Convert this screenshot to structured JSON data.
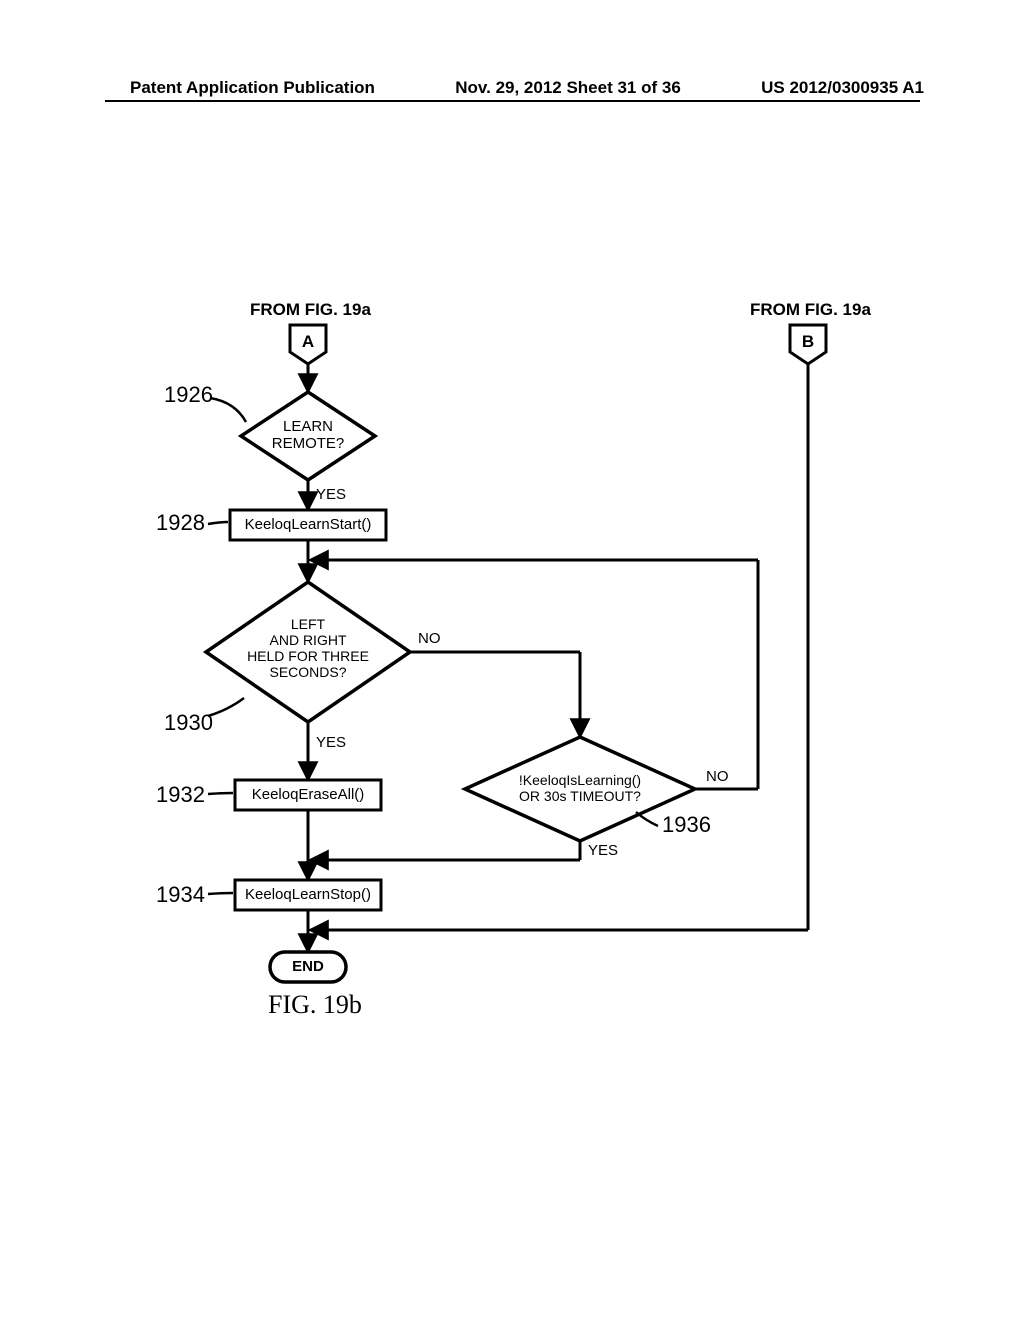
{
  "header": {
    "left": "Patent Application Publication",
    "center": "Nov. 29, 2012  Sheet 31 of 36",
    "right": "US 2012/0300935 A1"
  },
  "labels": {
    "fromA": "FROM FIG. 19a",
    "fromB": "FROM FIG. 19a",
    "connA": "A",
    "connB": "B",
    "d_learn_remote": "LEARN\nREMOTE?",
    "p_learn_start": "KeeloqLearnStart()",
    "d_held_three": "LEFT\nAND RIGHT\nHELD FOR THREE\nSECONDS?",
    "p_erase_all": "KeeloqEraseAll()",
    "p_learn_stop": "KeeloqLearnStop()",
    "d_timeout": "!KeeloqIsLearning()\nOR 30s TIMEOUT?",
    "end": "END",
    "yes": "YES",
    "no": "NO"
  },
  "refs": {
    "r1926": "1926",
    "r1928": "1928",
    "r1930": "1930",
    "r1932": "1932",
    "r1934": "1934",
    "r1936": "1936"
  },
  "figure_caption": "FIG. 19b"
}
